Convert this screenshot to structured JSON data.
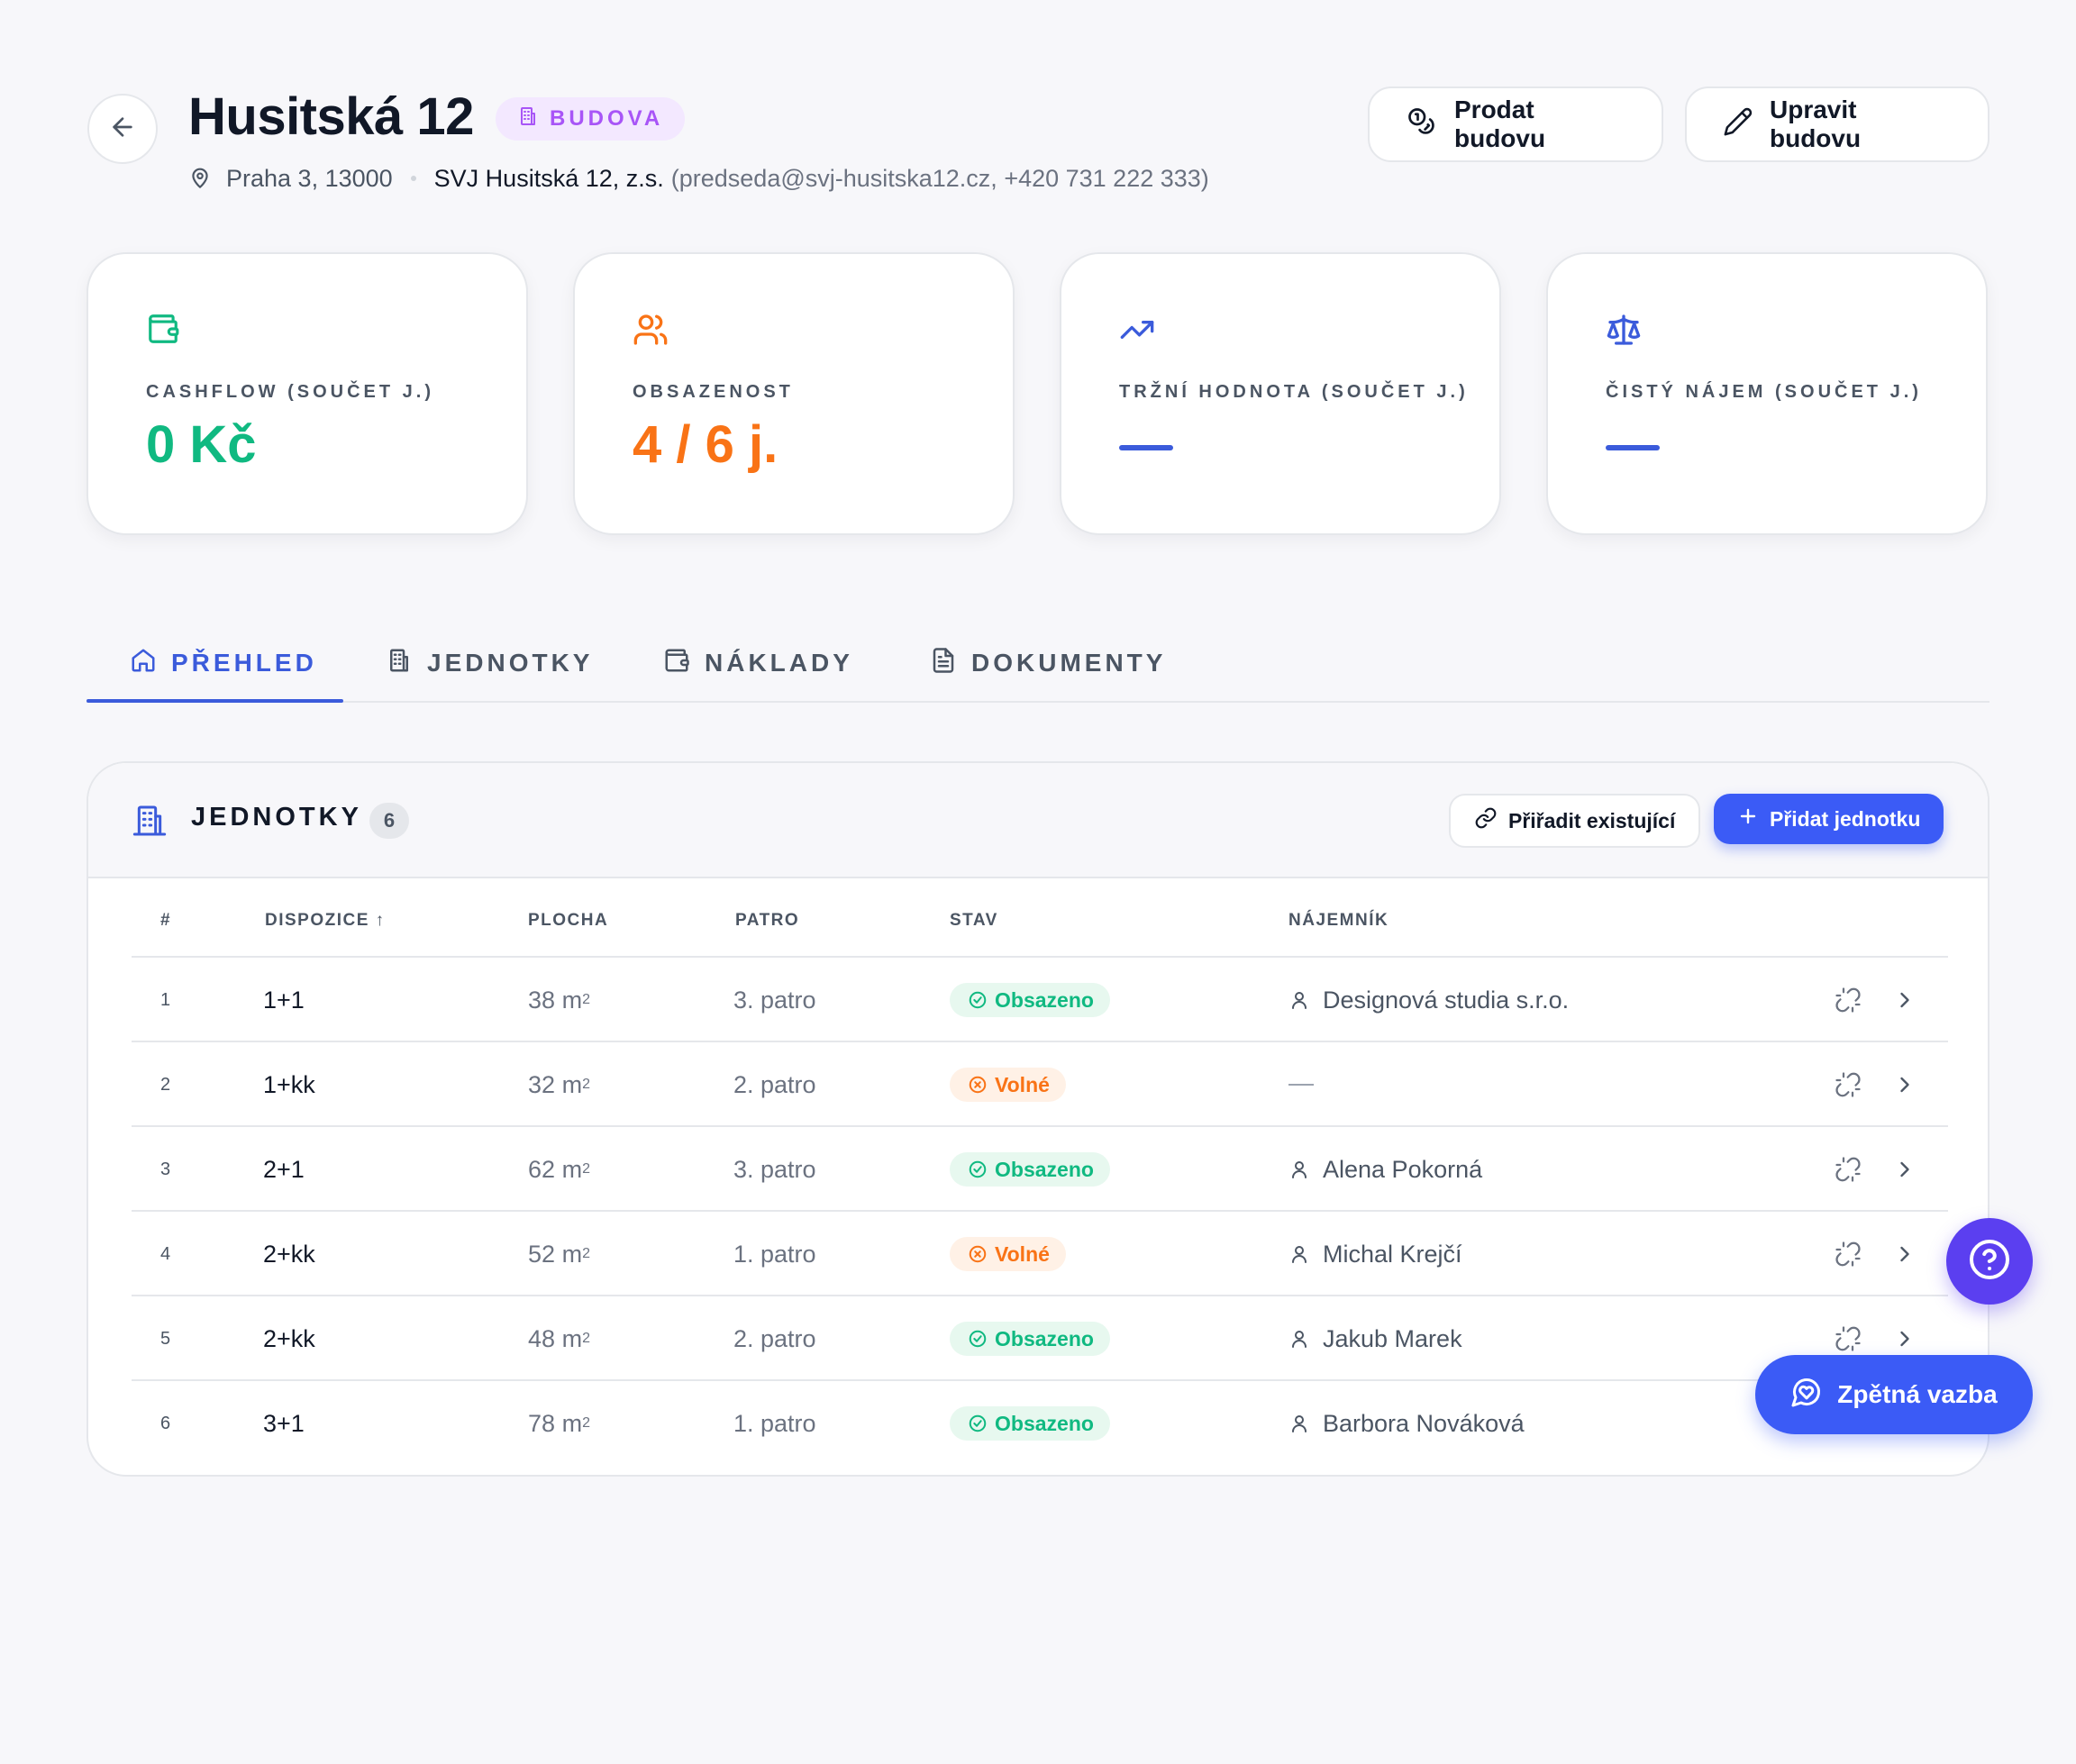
{
  "building": {
    "title": "Husitská 12",
    "type_badge": "BUDOVA",
    "location": "Praha 3, 13000",
    "svj_name": "SVJ Husitská 12, z.s.",
    "svj_contact": "(predseda@svj-husitska12.cz, +420 731 222 333)"
  },
  "actions": {
    "sell": "Prodat budovu",
    "edit": "Upravit budovu"
  },
  "kpis": [
    {
      "label": "CASHFLOW (SOUČET J.)",
      "value": "0 Kč",
      "color": "#10b981",
      "icon": "wallet-icon"
    },
    {
      "label": "OBSAZENOST",
      "value": "4 / 6 j.",
      "color": "#f97316",
      "icon": "users-icon"
    },
    {
      "label": "TRŽNÍ HODNOTA (SOUČET J.)",
      "value": "",
      "color": "#3b5bdb",
      "icon": "trending-up-icon"
    },
    {
      "label": "ČISTÝ NÁJEM (SOUČET J.)",
      "value": "",
      "color": "#3b5bdb",
      "icon": "scale-icon"
    }
  ],
  "tabs": [
    {
      "label": "PŘEHLED",
      "icon": "home-icon",
      "active": true
    },
    {
      "label": "JEDNOTKY",
      "icon": "building-icon",
      "active": false
    },
    {
      "label": "NÁKLADY",
      "icon": "wallet-icon",
      "active": false
    },
    {
      "label": "DOKUMENTY",
      "icon": "document-icon",
      "active": false
    }
  ],
  "units_panel": {
    "title": "JEDNOTKY",
    "count": "6",
    "assign_label": "Přiřadit existující",
    "add_label": "Přidat jednotku",
    "columns": [
      "#",
      "DISPOZICE ↑",
      "PLOCHA",
      "PATRO",
      "STAV",
      "NÁJEMNÍK"
    ],
    "area_unit": "m",
    "area_unit_sup": "2",
    "rows": [
      {
        "num": "1",
        "disposition": "1+1",
        "area": "38",
        "floor": "3. patro",
        "status": "Obsazeno",
        "status_type": "occupied",
        "tenant": "Designová studia s.r.o."
      },
      {
        "num": "2",
        "disposition": "1+kk",
        "area": "32",
        "floor": "2. patro",
        "status": "Volné",
        "status_type": "free",
        "tenant": ""
      },
      {
        "num": "3",
        "disposition": "2+1",
        "area": "62",
        "floor": "3. patro",
        "status": "Obsazeno",
        "status_type": "occupied",
        "tenant": "Alena Pokorná"
      },
      {
        "num": "4",
        "disposition": "2+kk",
        "area": "52",
        "floor": "1. patro",
        "status": "Volné",
        "status_type": "free",
        "tenant": "Michal Krejčí"
      },
      {
        "num": "5",
        "disposition": "2+kk",
        "area": "48",
        "floor": "2. patro",
        "status": "Obsazeno",
        "status_type": "occupied",
        "tenant": "Jakub Marek"
      },
      {
        "num": "6",
        "disposition": "3+1",
        "area": "78",
        "floor": "1. patro",
        "status": "Obsazeno",
        "status_type": "occupied",
        "tenant": "Barbora Nováková"
      }
    ]
  },
  "floating": {
    "feedback_label": "Zpětná vazba"
  },
  "colors": {
    "primary": "#3b5bf6",
    "accent_purple": "#a855f7",
    "success": "#10b981",
    "warning": "#f97316",
    "help_fab": "#5b3ff0"
  }
}
